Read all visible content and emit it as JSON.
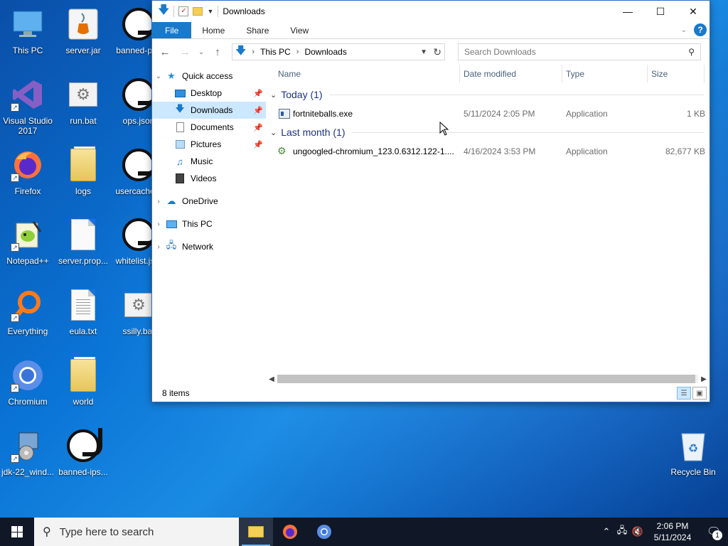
{
  "desktop": {
    "icons": [
      {
        "label": "This PC",
        "icon": "this-pc-icon"
      },
      {
        "label": "server.jar",
        "icon": "java-jar-icon"
      },
      {
        "label": "banned-pl...",
        "icon": "json-file-icon"
      },
      {
        "label": "Visual Studio 2017",
        "icon": "visual-studio-icon"
      },
      {
        "label": "run.bat",
        "icon": "batch-file-icon"
      },
      {
        "label": "ops.json",
        "icon": "json-file-icon"
      },
      {
        "label": "Firefox",
        "icon": "firefox-icon"
      },
      {
        "label": "logs",
        "icon": "folder-icon"
      },
      {
        "label": "usercache...",
        "icon": "json-file-icon"
      },
      {
        "label": "Notepad++",
        "icon": "notepadpp-icon"
      },
      {
        "label": "server.prop...",
        "icon": "blank-file-icon"
      },
      {
        "label": "whitelist.js...",
        "icon": "json-file-icon"
      },
      {
        "label": "Everything",
        "icon": "everything-search-icon"
      },
      {
        "label": "eula.txt",
        "icon": "text-file-icon"
      },
      {
        "label": "ssilly.bat",
        "icon": "batch-file-icon"
      },
      {
        "label": "Chromium",
        "icon": "chromium-icon"
      },
      {
        "label": "world",
        "icon": "folder-icon"
      },
      {
        "label": "jdk-22_wind...",
        "icon": "installer-icon"
      },
      {
        "label": "banned-ips...",
        "icon": "json-file-icon"
      },
      {
        "label": "Recycle Bin",
        "icon": "recycle-bin-icon"
      }
    ]
  },
  "window": {
    "title": "Downloads",
    "ribbon_tabs": [
      "File",
      "Home",
      "Share",
      "View"
    ],
    "address": {
      "segments": [
        "This PC",
        "Downloads"
      ]
    },
    "search_placeholder": "Search Downloads",
    "nav": {
      "quick_access": "Quick access",
      "quick_items": [
        {
          "label": "Desktop",
          "icon": "desktop-icon",
          "pinned": true
        },
        {
          "label": "Downloads",
          "icon": "downloads-icon",
          "pinned": true,
          "selected": true
        },
        {
          "label": "Documents",
          "icon": "documents-icon",
          "pinned": true
        },
        {
          "label": "Pictures",
          "icon": "pictures-icon",
          "pinned": true
        },
        {
          "label": "Music",
          "icon": "music-icon"
        },
        {
          "label": "Videos",
          "icon": "videos-icon"
        }
      ],
      "roots": [
        {
          "label": "OneDrive",
          "icon": "onedrive-icon"
        },
        {
          "label": "This PC",
          "icon": "this-pc-icon"
        },
        {
          "label": "Network",
          "icon": "network-icon"
        }
      ]
    },
    "columns": {
      "name": "Name",
      "date": "Date modified",
      "type": "Type",
      "size": "Size"
    },
    "groups": [
      {
        "label": "Today (1)",
        "files": [
          {
            "name": "fortniteballs.exe",
            "date": "5/11/2024 2:05 PM",
            "type": "Application",
            "size": "1 KB"
          }
        ]
      },
      {
        "label": "Last month (1)",
        "files": [
          {
            "name": "ungoogled-chromium_123.0.6312.122-1....",
            "date": "4/16/2024 3:53 PM",
            "type": "Application",
            "size": "82,677 KB"
          }
        ]
      }
    ],
    "status": "8 items"
  },
  "taskbar": {
    "search_placeholder": "Type here to search",
    "apps": [
      "file-explorer-icon",
      "firefox-icon",
      "chromium-icon"
    ],
    "clock_time": "2:06 PM",
    "clock_date": "5/11/2024",
    "notification_count": "1"
  }
}
